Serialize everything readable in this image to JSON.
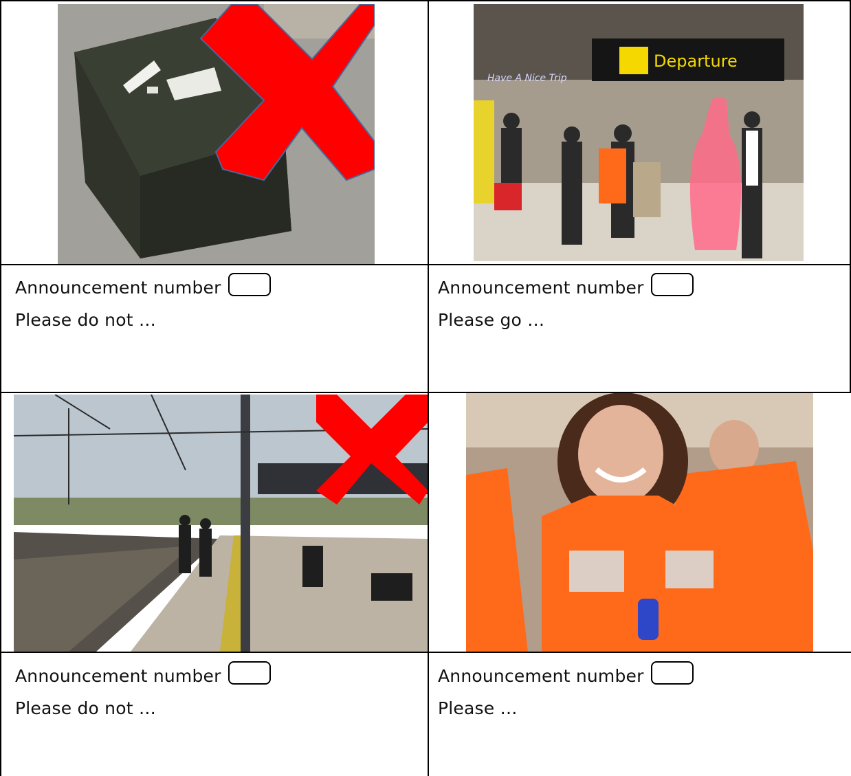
{
  "cells": [
    {
      "announcement_label": "Announcement number",
      "prompt": "Please do not …",
      "answer_line": "_____________________________________",
      "photo": "unattended-suitcase-with-red-cross"
    },
    {
      "announcement_label": "Announcement number",
      "prompt": "Please go …",
      "answer_line": "_____________________________________",
      "photo": "airport-departure-hall",
      "sign_text": "Departure",
      "banner_text": "Have A Nice Trip"
    },
    {
      "announcement_label": "Announcement number",
      "prompt": "Please do not …",
      "answer_line": "_____________________________________",
      "photo": "train-platform-with-red-cross"
    },
    {
      "announcement_label": "Announcement number",
      "prompt": "Please …",
      "answer_line": "_____________________________________",
      "photo": "woman-wearing-life-jacket"
    }
  ],
  "colors": {
    "cross_red": "#ff0000",
    "sign_yellow": "#f5d800",
    "lifejacket_orange": "#ff6a1a"
  }
}
